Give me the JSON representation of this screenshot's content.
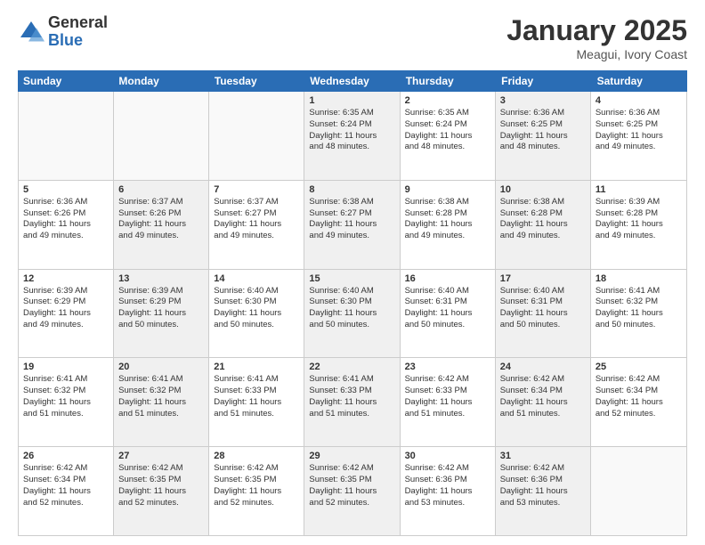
{
  "logo": {
    "general": "General",
    "blue": "Blue"
  },
  "title": "January 2025",
  "subtitle": "Meagui, Ivory Coast",
  "weekdays": [
    "Sunday",
    "Monday",
    "Tuesday",
    "Wednesday",
    "Thursday",
    "Friday",
    "Saturday"
  ],
  "weeks": [
    [
      {
        "day": "",
        "info": "",
        "empty": true
      },
      {
        "day": "",
        "info": "",
        "empty": true
      },
      {
        "day": "",
        "info": "",
        "empty": true
      },
      {
        "day": "1",
        "info": "Sunrise: 6:35 AM\nSunset: 6:24 PM\nDaylight: 11 hours\nand 48 minutes.",
        "shaded": true
      },
      {
        "day": "2",
        "info": "Sunrise: 6:35 AM\nSunset: 6:24 PM\nDaylight: 11 hours\nand 48 minutes.",
        "shaded": false
      },
      {
        "day": "3",
        "info": "Sunrise: 6:36 AM\nSunset: 6:25 PM\nDaylight: 11 hours\nand 48 minutes.",
        "shaded": true
      },
      {
        "day": "4",
        "info": "Sunrise: 6:36 AM\nSunset: 6:25 PM\nDaylight: 11 hours\nand 49 minutes.",
        "shaded": false
      }
    ],
    [
      {
        "day": "5",
        "info": "Sunrise: 6:36 AM\nSunset: 6:26 PM\nDaylight: 11 hours\nand 49 minutes.",
        "shaded": false
      },
      {
        "day": "6",
        "info": "Sunrise: 6:37 AM\nSunset: 6:26 PM\nDaylight: 11 hours\nand 49 minutes.",
        "shaded": true
      },
      {
        "day": "7",
        "info": "Sunrise: 6:37 AM\nSunset: 6:27 PM\nDaylight: 11 hours\nand 49 minutes.",
        "shaded": false
      },
      {
        "day": "8",
        "info": "Sunrise: 6:38 AM\nSunset: 6:27 PM\nDaylight: 11 hours\nand 49 minutes.",
        "shaded": true
      },
      {
        "day": "9",
        "info": "Sunrise: 6:38 AM\nSunset: 6:28 PM\nDaylight: 11 hours\nand 49 minutes.",
        "shaded": false
      },
      {
        "day": "10",
        "info": "Sunrise: 6:38 AM\nSunset: 6:28 PM\nDaylight: 11 hours\nand 49 minutes.",
        "shaded": true
      },
      {
        "day": "11",
        "info": "Sunrise: 6:39 AM\nSunset: 6:28 PM\nDaylight: 11 hours\nand 49 minutes.",
        "shaded": false
      }
    ],
    [
      {
        "day": "12",
        "info": "Sunrise: 6:39 AM\nSunset: 6:29 PM\nDaylight: 11 hours\nand 49 minutes.",
        "shaded": false
      },
      {
        "day": "13",
        "info": "Sunrise: 6:39 AM\nSunset: 6:29 PM\nDaylight: 11 hours\nand 50 minutes.",
        "shaded": true
      },
      {
        "day": "14",
        "info": "Sunrise: 6:40 AM\nSunset: 6:30 PM\nDaylight: 11 hours\nand 50 minutes.",
        "shaded": false
      },
      {
        "day": "15",
        "info": "Sunrise: 6:40 AM\nSunset: 6:30 PM\nDaylight: 11 hours\nand 50 minutes.",
        "shaded": true
      },
      {
        "day": "16",
        "info": "Sunrise: 6:40 AM\nSunset: 6:31 PM\nDaylight: 11 hours\nand 50 minutes.",
        "shaded": false
      },
      {
        "day": "17",
        "info": "Sunrise: 6:40 AM\nSunset: 6:31 PM\nDaylight: 11 hours\nand 50 minutes.",
        "shaded": true
      },
      {
        "day": "18",
        "info": "Sunrise: 6:41 AM\nSunset: 6:32 PM\nDaylight: 11 hours\nand 50 minutes.",
        "shaded": false
      }
    ],
    [
      {
        "day": "19",
        "info": "Sunrise: 6:41 AM\nSunset: 6:32 PM\nDaylight: 11 hours\nand 51 minutes.",
        "shaded": false
      },
      {
        "day": "20",
        "info": "Sunrise: 6:41 AM\nSunset: 6:32 PM\nDaylight: 11 hours\nand 51 minutes.",
        "shaded": true
      },
      {
        "day": "21",
        "info": "Sunrise: 6:41 AM\nSunset: 6:33 PM\nDaylight: 11 hours\nand 51 minutes.",
        "shaded": false
      },
      {
        "day": "22",
        "info": "Sunrise: 6:41 AM\nSunset: 6:33 PM\nDaylight: 11 hours\nand 51 minutes.",
        "shaded": true
      },
      {
        "day": "23",
        "info": "Sunrise: 6:42 AM\nSunset: 6:33 PM\nDaylight: 11 hours\nand 51 minutes.",
        "shaded": false
      },
      {
        "day": "24",
        "info": "Sunrise: 6:42 AM\nSunset: 6:34 PM\nDaylight: 11 hours\nand 51 minutes.",
        "shaded": true
      },
      {
        "day": "25",
        "info": "Sunrise: 6:42 AM\nSunset: 6:34 PM\nDaylight: 11 hours\nand 52 minutes.",
        "shaded": false
      }
    ],
    [
      {
        "day": "26",
        "info": "Sunrise: 6:42 AM\nSunset: 6:34 PM\nDaylight: 11 hours\nand 52 minutes.",
        "shaded": false
      },
      {
        "day": "27",
        "info": "Sunrise: 6:42 AM\nSunset: 6:35 PM\nDaylight: 11 hours\nand 52 minutes.",
        "shaded": true
      },
      {
        "day": "28",
        "info": "Sunrise: 6:42 AM\nSunset: 6:35 PM\nDaylight: 11 hours\nand 52 minutes.",
        "shaded": false
      },
      {
        "day": "29",
        "info": "Sunrise: 6:42 AM\nSunset: 6:35 PM\nDaylight: 11 hours\nand 52 minutes.",
        "shaded": true
      },
      {
        "day": "30",
        "info": "Sunrise: 6:42 AM\nSunset: 6:36 PM\nDaylight: 11 hours\nand 53 minutes.",
        "shaded": false
      },
      {
        "day": "31",
        "info": "Sunrise: 6:42 AM\nSunset: 6:36 PM\nDaylight: 11 hours\nand 53 minutes.",
        "shaded": true
      },
      {
        "day": "",
        "info": "",
        "empty": true
      }
    ]
  ]
}
